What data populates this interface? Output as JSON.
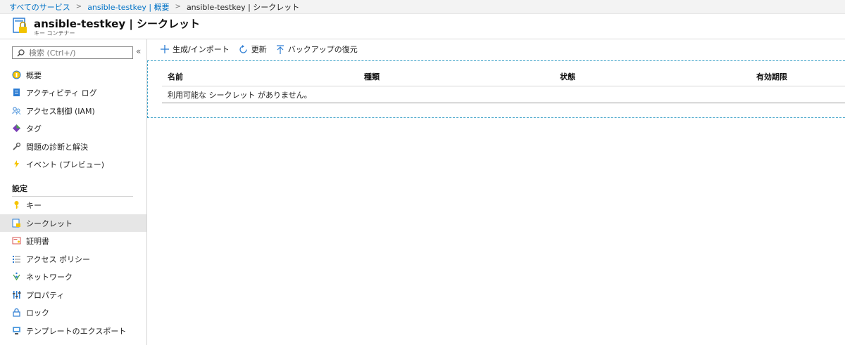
{
  "breadcrumb": {
    "items": [
      "すべてのサービス",
      "ansible-testkey | 概要"
    ],
    "current": "ansible-testkey | シークレット"
  },
  "header": {
    "title": "ansible-testkey | シークレット",
    "subtitle": "キー コンテナー"
  },
  "search": {
    "placeholder": "検索 (Ctrl+/)"
  },
  "sidebar": {
    "items": [
      "概要",
      "アクティビティ ログ",
      "アクセス制御 (IAM)",
      "タグ",
      "問題の診断と解決",
      "イベント (プレビュー)"
    ],
    "section_title": "設定",
    "settings_items": [
      "キー",
      "シークレット",
      "証明書",
      "アクセス ポリシー",
      "ネットワーク",
      "プロパティ",
      "ロック",
      "テンプレートのエクスポート"
    ]
  },
  "toolbar": {
    "generate_label": "生成/インポート",
    "refresh_label": "更新",
    "restore_label": "バックアップの復元"
  },
  "grid": {
    "columns": [
      "名前",
      "種類",
      "状態",
      "有効期限"
    ],
    "empty_message": "利用可能な シークレット がありません。"
  },
  "colors": {
    "link": "#0072c6",
    "accent": "#3aa0c7"
  }
}
